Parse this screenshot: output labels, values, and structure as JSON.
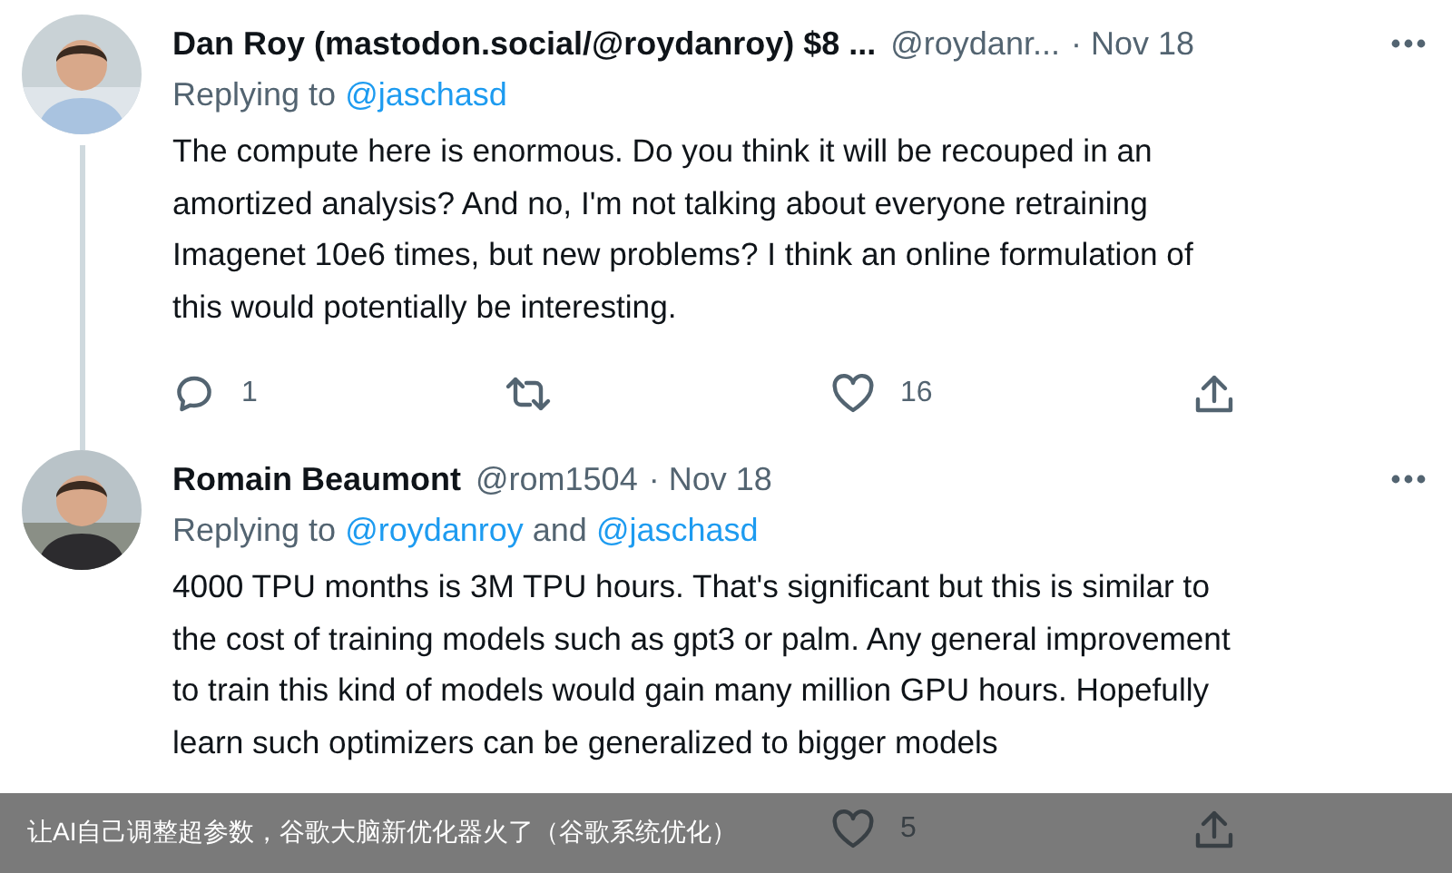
{
  "tweets": [
    {
      "name": "Dan Roy (mastodon.social/@roydanroy) $8 ...",
      "handle": "@roydanr...",
      "date": "· Nov 18",
      "thread_line": true,
      "replying": [
        {
          "kind": "plain",
          "text": "Replying to"
        },
        {
          "kind": "mention",
          "text": "@jaschasd"
        }
      ],
      "text": "The compute here is enormous. Do you think it will be recouped in an\namortized analysis? And no, I'm not talking about everyone retraining\nImagenet 10e6 times, but new problems? I think an online formulation of\nthis would potentially be interesting.",
      "actions": [
        {
          "kind": "reply",
          "count": "1"
        },
        {
          "kind": "retweet"
        },
        {
          "kind": "like",
          "count": "16"
        },
        {
          "kind": "share"
        }
      ]
    },
    {
      "name": "Romain Beaumont",
      "handle": "@rom1504",
      "date": "· Nov 18",
      "thread_line": false,
      "replying": [
        {
          "kind": "plain",
          "text": "Replying to"
        },
        {
          "kind": "mention",
          "text": "@roydanroy"
        },
        {
          "kind": "plain",
          "text": "and"
        },
        {
          "kind": "mention",
          "text": "@jaschasd"
        }
      ],
      "text": "4000 TPU months is 3M TPU hours. That's significant but this is similar to\nthe cost of training models such as gpt3 or palm. Any general improvement\nto train this kind of models would gain many million GPU hours. Hopefully\nlearn such optimizers can be generalized to bigger models",
      "actions": [
        {
          "kind": "like",
          "count": "5"
        },
        {
          "kind": "share"
        }
      ]
    }
  ],
  "caption": "让AI自己调整超参数，谷歌大脑新优化器火了（谷歌系统优化）"
}
